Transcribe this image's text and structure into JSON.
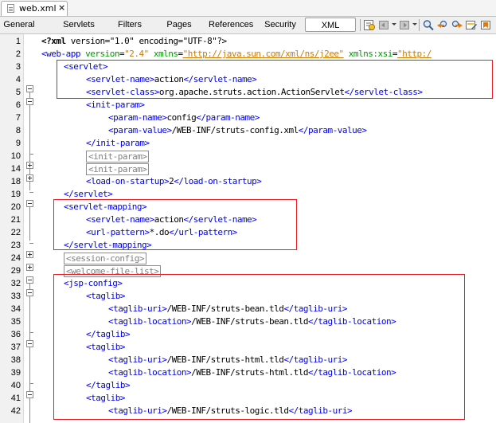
{
  "file_tab": {
    "label": "web.xml",
    "close": "×"
  },
  "view_tabs": [
    "General",
    "Servlets",
    "Filters",
    "Pages",
    "References",
    "Security",
    "XML"
  ],
  "active_view_tab": "XML",
  "toolbar_icons": [
    "history-icon",
    "back-icon",
    "forward-icon",
    "find-icon",
    "prev-occurrence-icon",
    "next-occurrence-icon",
    "toggle-highlight-icon"
  ],
  "editor": {
    "line_numbers": [
      "1",
      "2",
      "3",
      "4",
      "5",
      "6",
      "7",
      "8",
      "9",
      "10",
      "14",
      "18",
      "19",
      "20",
      "21",
      "22",
      "23",
      "24",
      "29",
      "32",
      "33",
      "34",
      "35",
      "36",
      "37",
      "38",
      "39",
      "40",
      "41",
      "42"
    ],
    "lines": [
      [
        {
          "t": "decl",
          "v": "<?xml"
        },
        {
          "t": "txt",
          "v": " version=\"1.0\" encoding=\"UTF-8\"?>"
        }
      ],
      [
        {
          "t": "tag",
          "v": "<web-app"
        },
        {
          "t": "txt",
          "v": " "
        },
        {
          "t": "attr",
          "v": "version"
        },
        {
          "t": "txt",
          "v": "="
        },
        {
          "t": "val",
          "v": "\"2.4\""
        },
        {
          "t": "txt",
          "v": " "
        },
        {
          "t": "attr",
          "v": "xmlns"
        },
        {
          "t": "txt",
          "v": "="
        },
        {
          "t": "url",
          "v": "\"http://java.sun.com/xml/ns/j2ee\""
        },
        {
          "t": "txt",
          "v": " "
        },
        {
          "t": "attr",
          "v": "xmlns:xsi"
        },
        {
          "t": "txt",
          "v": "="
        },
        {
          "t": "url",
          "v": "\"http:/"
        }
      ],
      [
        {
          "t": "tag",
          "v": "<servlet>"
        }
      ],
      [
        {
          "t": "tag",
          "v": "<servlet-name>"
        },
        {
          "t": "txt",
          "v": "action"
        },
        {
          "t": "tag",
          "v": "</servlet-name>"
        }
      ],
      [
        {
          "t": "tag",
          "v": "<servlet-class>"
        },
        {
          "t": "txt",
          "v": "org.apache.struts.action.ActionServlet"
        },
        {
          "t": "tag",
          "v": "</servlet-class>"
        }
      ],
      [
        {
          "t": "tag",
          "v": "<init-param>"
        }
      ],
      [
        {
          "t": "tag",
          "v": "<param-name>"
        },
        {
          "t": "txt",
          "v": "config"
        },
        {
          "t": "tag",
          "v": "</param-name>"
        }
      ],
      [
        {
          "t": "tag",
          "v": "<param-value>"
        },
        {
          "t": "txt",
          "v": "/WEB-INF/struts-config.xml"
        },
        {
          "t": "tag",
          "v": "</param-value>"
        }
      ],
      [
        {
          "t": "tag",
          "v": "</init-param>"
        }
      ],
      [
        {
          "t": "folded",
          "v": "<init-param>"
        }
      ],
      [
        {
          "t": "folded",
          "v": "<init-param>"
        }
      ],
      [
        {
          "t": "tag",
          "v": "<load-on-startup>"
        },
        {
          "t": "txt",
          "v": "2"
        },
        {
          "t": "tag",
          "v": "</load-on-startup>"
        }
      ],
      [
        {
          "t": "tag",
          "v": "</servlet>"
        }
      ],
      [
        {
          "t": "tag",
          "v": "<servlet-mapping>"
        }
      ],
      [
        {
          "t": "tag",
          "v": "<servlet-name>"
        },
        {
          "t": "txt",
          "v": "action"
        },
        {
          "t": "tag",
          "v": "</servlet-name>"
        }
      ],
      [
        {
          "t": "tag",
          "v": "<url-pattern>"
        },
        {
          "t": "txt",
          "v": "*.do"
        },
        {
          "t": "tag",
          "v": "</url-pattern>"
        }
      ],
      [
        {
          "t": "tag",
          "v": "</servlet-mapping>"
        }
      ],
      [
        {
          "t": "folded",
          "v": "<session-config>"
        }
      ],
      [
        {
          "t": "folded",
          "v": "<welcome-file-list>"
        }
      ],
      [
        {
          "t": "tag",
          "v": "<jsp-config>"
        }
      ],
      [
        {
          "t": "tag",
          "v": "<taglib>"
        }
      ],
      [
        {
          "t": "tag",
          "v": "<taglib-uri>"
        },
        {
          "t": "txt",
          "v": "/WEB-INF/struts-bean.tld"
        },
        {
          "t": "tag",
          "v": "</taglib-uri>"
        }
      ],
      [
        {
          "t": "tag",
          "v": "<taglib-location>"
        },
        {
          "t": "txt",
          "v": "/WEB-INF/struts-bean.tld"
        },
        {
          "t": "tag",
          "v": "</taglib-location>"
        }
      ],
      [
        {
          "t": "tag",
          "v": "</taglib>"
        }
      ],
      [
        {
          "t": "tag",
          "v": "<taglib>"
        }
      ],
      [
        {
          "t": "tag",
          "v": "<taglib-uri>"
        },
        {
          "t": "txt",
          "v": "/WEB-INF/struts-html.tld"
        },
        {
          "t": "tag",
          "v": "</taglib-uri>"
        }
      ],
      [
        {
          "t": "tag",
          "v": "<taglib-location>"
        },
        {
          "t": "txt",
          "v": "/WEB-INF/struts-html.tld"
        },
        {
          "t": "tag",
          "v": "</taglib-location>"
        }
      ],
      [
        {
          "t": "tag",
          "v": "</taglib>"
        }
      ],
      [
        {
          "t": "tag",
          "v": "<taglib>"
        }
      ],
      [
        {
          "t": "tag",
          "v": "<taglib-uri>"
        },
        {
          "t": "txt",
          "v": "/WEB-INF/struts-logic.tld"
        },
        {
          "t": "tag",
          "v": "</taglib-uri>"
        }
      ]
    ]
  },
  "colors": {
    "tag": "#0000e6",
    "attribute": "#009900",
    "value": "#ce7b00",
    "text": "#000000",
    "highlight_box": "#ec1c24"
  }
}
